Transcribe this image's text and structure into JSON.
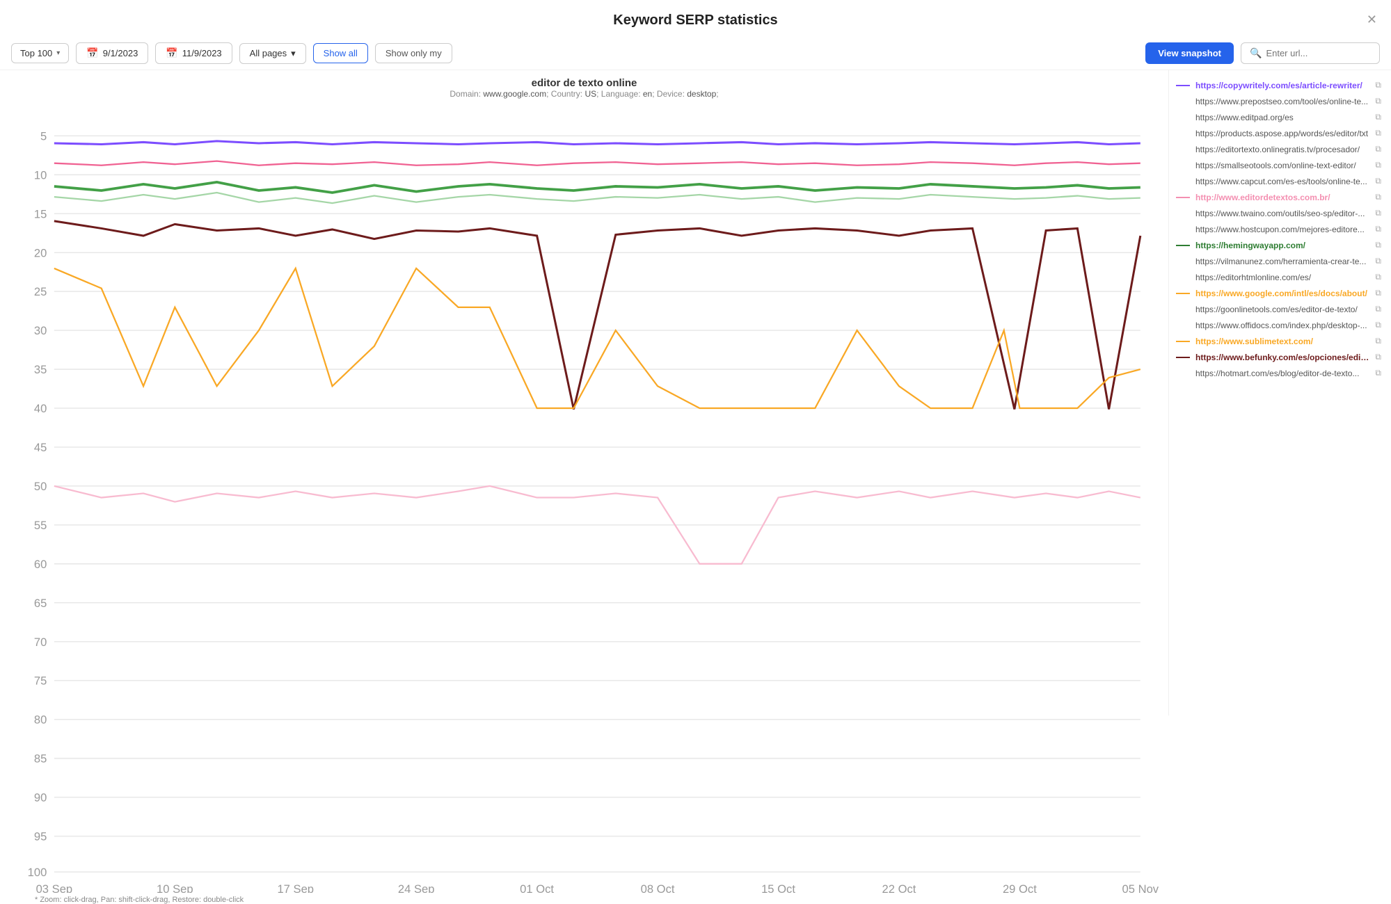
{
  "header": {
    "title": "Keyword SERP statistics",
    "close_label": "✕"
  },
  "toolbar": {
    "top100_label": "Top 100",
    "date1_label": "9/1/2023",
    "date2_label": "11/9/2023",
    "all_pages_label": "All pages",
    "show_all_label": "Show all",
    "show_only_my_label": "Show only my",
    "view_snapshot_label": "View snapshot",
    "url_placeholder": "Enter url..."
  },
  "chart": {
    "title": "editor de texto online",
    "subtitle": "Domain: www.google.com; Country: US; Language: en; Device: desktop;",
    "hint": "* Zoom: click-drag, Pan: shift-click-drag, Restore: double-click",
    "x_labels": [
      "03 Sep",
      "10 Sep",
      "17 Sep",
      "24 Sep",
      "01 Oct",
      "08 Oct",
      "15 Oct",
      "22 Oct",
      "29 Oct",
      "05 Nov"
    ],
    "y_labels": [
      "5",
      "10",
      "15",
      "20",
      "25",
      "30",
      "35",
      "40",
      "45",
      "50",
      "55",
      "60",
      "65",
      "70",
      "75",
      "80",
      "85",
      "90",
      "95",
      "100"
    ]
  },
  "legend": {
    "items": [
      {
        "url": "https://copywritely.com/es/article-rewriter/",
        "color": "#7c4dff",
        "bold": true,
        "has_line": true
      },
      {
        "url": "https://www.prepostseo.com/tool/es/online-te...",
        "color": "#aaa",
        "bold": false,
        "has_line": false
      },
      {
        "url": "https://www.editpad.org/es",
        "color": "#aaa",
        "bold": false,
        "has_line": false
      },
      {
        "url": "https://products.aspose.app/words/es/editor/txt",
        "color": "#aaa",
        "bold": false,
        "has_line": false
      },
      {
        "url": "https://editortexto.onlinegratis.tv/procesador/",
        "color": "#aaa",
        "bold": false,
        "has_line": false
      },
      {
        "url": "https://smallseotools.com/online-text-editor/",
        "color": "#aaa",
        "bold": false,
        "has_line": false
      },
      {
        "url": "https://www.capcut.com/es-es/tools/online-te...",
        "color": "#aaa",
        "bold": false,
        "has_line": false
      },
      {
        "url": "http://www.editordetextos.com.br/",
        "color": "#f48fb1",
        "bold": true,
        "has_line": true
      },
      {
        "url": "https://www.twaino.com/outils/seo-sp/editor-...",
        "color": "#aaa",
        "bold": false,
        "has_line": false
      },
      {
        "url": "https://www.hostcupon.com/mejores-editore...",
        "color": "#aaa",
        "bold": false,
        "has_line": false
      },
      {
        "url": "https://hemingwayapp.com/",
        "color": "#2e7d32",
        "bold": true,
        "has_line": true
      },
      {
        "url": "https://vilmanunez.com/herramienta-crear-te...",
        "color": "#aaa",
        "bold": false,
        "has_line": false
      },
      {
        "url": "https://editorhtmlonline.com/es/",
        "color": "#aaa",
        "bold": false,
        "has_line": false
      },
      {
        "url": "https://www.google.com/intl/es/docs/about/",
        "color": "#f9a825",
        "bold": true,
        "has_line": true
      },
      {
        "url": "https://goonlinetools.com/es/editor-de-texto/",
        "color": "#aaa",
        "bold": false,
        "has_line": false
      },
      {
        "url": "https://www.offidocs.com/index.php/desktop-...",
        "color": "#aaa",
        "bold": false,
        "has_line": false
      },
      {
        "url": "https://www.sublimetext.com/",
        "color": "#f9a825",
        "bold": true,
        "has_line": true
      },
      {
        "url": "https://www.befunky.com/es/opciones/editor-...",
        "color": "#6d1b1b",
        "bold": true,
        "has_line": true
      },
      {
        "url": "https://hotmart.com/es/blog/editor-de-texto...",
        "color": "#aaa",
        "bold": false,
        "has_line": false
      }
    ]
  }
}
